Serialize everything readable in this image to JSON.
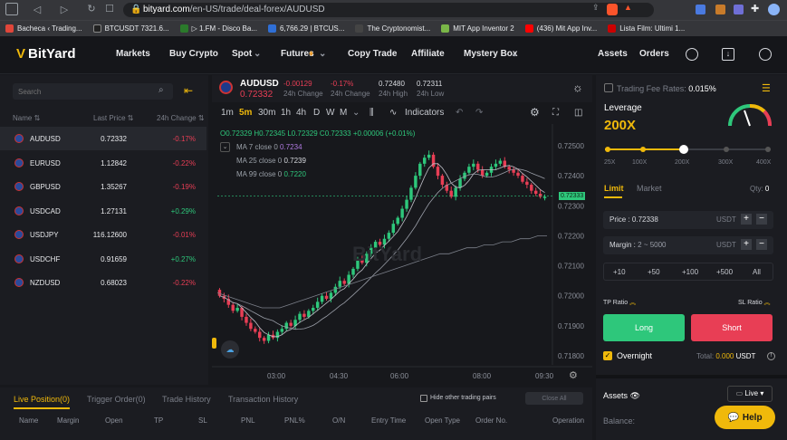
{
  "browser": {
    "url_host": "bityard.com",
    "url_path": "/en-US/trade/deal-forex/AUDUSD",
    "bookmarks": [
      "Bacheca ‹ Trading...",
      "BTCUSDT 7321.6...",
      "▷ 1.FM - Disco Ba...",
      "6,766.29 | BTCUS...",
      "The Cryptonomist...",
      "MIT App Inventor 2",
      "(436) Mit App Inv...",
      "Lista Film: Ultimi 1..."
    ]
  },
  "nav": {
    "logo": "BitYard",
    "items": [
      "Markets",
      "Buy Crypto",
      "Spot",
      "Futures",
      "Copy Trade",
      "Affiliate",
      "Mystery Box"
    ],
    "assets": "Assets",
    "orders": "Orders"
  },
  "market": {
    "search_placeholder": "Search",
    "col_name": "Name",
    "col_price": "Last Price",
    "col_change": "24h Change",
    "rows": [
      {
        "name": "AUDUSD",
        "price": "0.72332",
        "change": "-0.17%"
      },
      {
        "name": "EURUSD",
        "price": "1.12842",
        "change": "-0.22%"
      },
      {
        "name": "GBPUSD",
        "price": "1.35267",
        "change": "-0.19%"
      },
      {
        "name": "USDCAD",
        "price": "1.27131",
        "change": "+0.29%"
      },
      {
        "name": "USDJPY",
        "price": "116.12600",
        "change": "-0.01%"
      },
      {
        "name": "USDCHF",
        "price": "0.91659",
        "change": "+0.27%"
      },
      {
        "name": "NZDUSD",
        "price": "0.68023",
        "change": "-0.22%"
      }
    ]
  },
  "ticker": {
    "symbol": "AUDUSD",
    "price": "0.72332",
    "change_val": "-0.00129",
    "change_val_label": "24h Change",
    "change_pct": "-0.17%",
    "change_pct_label": "24h Change",
    "high": "0.72480",
    "high_label": "24h High",
    "low": "0.72311",
    "low_label": "24h Low"
  },
  "toolbar": {
    "timeframes": [
      "1m",
      "5m",
      "30m",
      "1h",
      "4h",
      "D",
      "W",
      "M"
    ],
    "indicators": "Indicators"
  },
  "ohlc": {
    "o": "O0.72329",
    "h": "H0.72345",
    "l": "L0.72329",
    "c": "C0.72333",
    "chg": "+0.00006 (+0.01%)",
    "ma7_label": "MA 7 close 0",
    "ma7": "0.7234",
    "ma25_label": "MA 25 close 0",
    "ma25": "0.7239",
    "ma99_label": "MA 99 close 0",
    "ma99": "0.7220"
  },
  "chart_data": {
    "type": "candlestick",
    "watermark": "BitYard",
    "y_ticks": [
      "0.72500",
      "0.72400",
      "0.72300",
      "0.72200",
      "0.72100",
      "0.72000",
      "0.71900",
      "0.71800"
    ],
    "x_ticks": [
      "03:00",
      "04:30",
      "06:00",
      "08:00",
      "09:30"
    ],
    "last_price": "0.72333",
    "closes": [
      0.72,
      0.7199,
      0.7197,
      0.7195,
      0.7196,
      0.7193,
      0.7191,
      0.7189,
      0.7188,
      0.7186,
      0.7185,
      0.7187,
      0.7186,
      0.7188,
      0.7189,
      0.7191,
      0.719,
      0.7192,
      0.7194,
      0.7193,
      0.7195,
      0.7196,
      0.7198,
      0.72,
      0.7199,
      0.7201,
      0.7203,
      0.7205,
      0.7204,
      0.7207,
      0.7209,
      0.7212,
      0.7211,
      0.7214,
      0.7216,
      0.7218,
      0.7217,
      0.7219,
      0.7221,
      0.7224,
      0.7226,
      0.7229,
      0.7232,
      0.7236,
      0.724,
      0.7244,
      0.7246,
      0.7247,
      0.7243,
      0.724,
      0.7237,
      0.7235,
      0.7233,
      0.7236,
      0.7239,
      0.7241,
      0.7243,
      0.7244,
      0.7242,
      0.724,
      0.7241,
      0.7243,
      0.7244,
      0.7245,
      0.7243,
      0.7242,
      0.7241,
      0.724,
      0.7238,
      0.7237,
      0.7235,
      0.7234,
      0.7233,
      0.7233
    ],
    "ma_slow": [
      0.7201,
      0.72,
      0.7199,
      0.7198,
      0.7197,
      0.7196,
      0.7196,
      0.7196,
      0.7197,
      0.7198,
      0.7199,
      0.72,
      0.7201,
      0.7202,
      0.7203,
      0.7204,
      0.7205,
      0.7206,
      0.7207,
      0.7208,
      0.7209,
      0.721,
      0.7211,
      0.7212,
      0.7213,
      0.7214,
      0.7214,
      0.7215,
      0.7216,
      0.7216,
      0.7217,
      0.7217,
      0.7218,
      0.7218,
      0.7219,
      0.7219,
      0.722,
      0.722
    ]
  },
  "trade": {
    "fee_label": "Trading Fee Rates:",
    "fee": "0.015%",
    "leverage_label": "Leverage",
    "leverage": "200X",
    "lev_marks": [
      "25X",
      "100X",
      "200X",
      "300X",
      "400X"
    ],
    "tab_limit": "Limit",
    "tab_market": "Market",
    "qty_label": "Qty:",
    "qty": "0",
    "price_label": "Price :",
    "price": "0.72338",
    "margin_label": "Margin :",
    "margin": "2 ~ 5000",
    "unit": "USDT",
    "quick": [
      "+10",
      "+50",
      "+100",
      "+500",
      "All"
    ],
    "tp_label": "TP Ratio",
    "sl_label": "SL Ratio",
    "long": "Long",
    "short": "Short",
    "overnight": "Overnight",
    "total_label": "Total:",
    "total": "0.000",
    "total_unit": "USDT",
    "assets_label": "Assets",
    "live": "Live",
    "balance_label": "Balance:",
    "help": "Help"
  },
  "bottom": {
    "tabs": [
      "Live Position(0)",
      "Trigger Order(0)",
      "Trade History",
      "Transaction History"
    ],
    "hide_label": "Hide other trading pairs",
    "close_all": "Close All",
    "cols": [
      "Name",
      "Margin",
      "Open",
      "TP",
      "SL",
      "PNL",
      "PNL%",
      "O/N",
      "Entry Time",
      "Open Type",
      "Order No.",
      "Operation"
    ]
  },
  "colors": {
    "accent": "#f0b90b",
    "up": "#2ec77b",
    "down": "#e83e55"
  }
}
